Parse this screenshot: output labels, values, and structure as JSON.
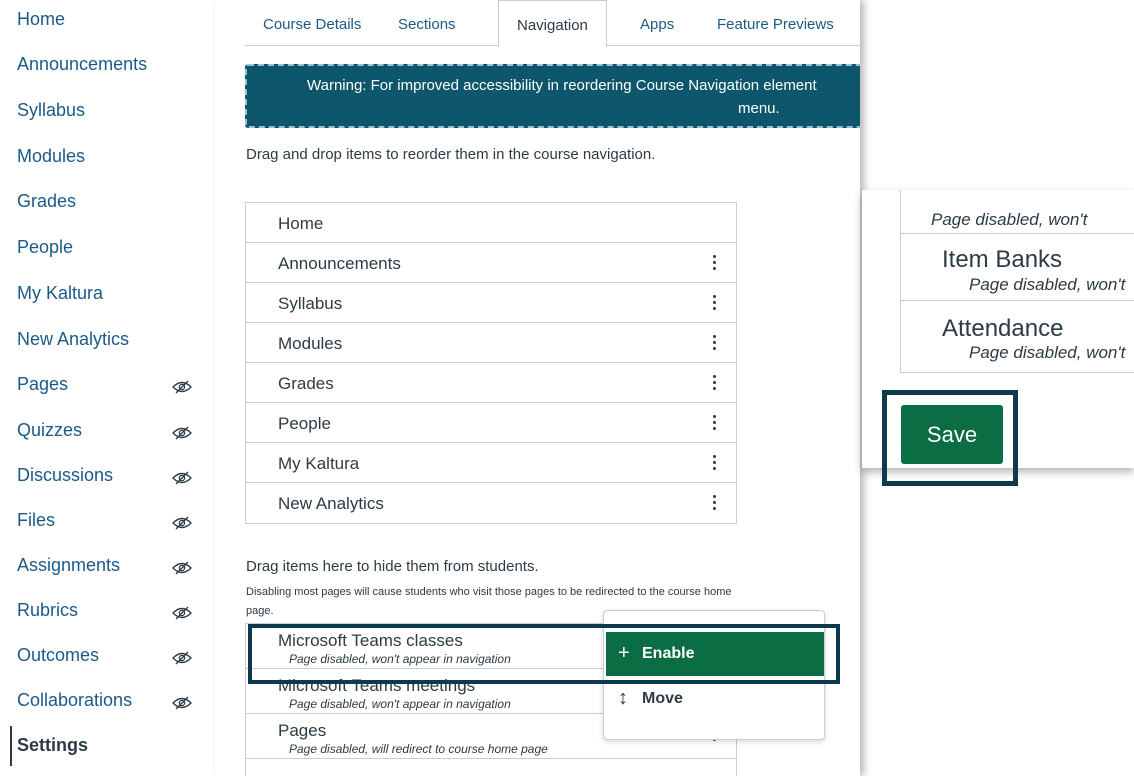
{
  "course_nav": {
    "items": [
      {
        "label": "Home",
        "hidden": false
      },
      {
        "label": "Announcements",
        "hidden": false
      },
      {
        "label": "Syllabus",
        "hidden": false
      },
      {
        "label": "Modules",
        "hidden": false
      },
      {
        "label": "Grades",
        "hidden": false
      },
      {
        "label": "People",
        "hidden": false
      },
      {
        "label": "My Kaltura",
        "hidden": false
      },
      {
        "label": "New Analytics",
        "hidden": false
      },
      {
        "label": "Pages",
        "hidden": true
      },
      {
        "label": "Quizzes",
        "hidden": true
      },
      {
        "label": "Discussions",
        "hidden": true
      },
      {
        "label": "Files",
        "hidden": true
      },
      {
        "label": "Assignments",
        "hidden": true
      },
      {
        "label": "Rubrics",
        "hidden": true
      },
      {
        "label": "Outcomes",
        "hidden": true
      },
      {
        "label": "Collaborations",
        "hidden": true
      },
      {
        "label": "Settings",
        "hidden": false,
        "active": true
      }
    ]
  },
  "tabs": [
    "Course Details",
    "Sections",
    "Navigation",
    "Apps",
    "Feature Previews"
  ],
  "active_tab": "Navigation",
  "warning": {
    "line1": "Warning: For improved accessibility in reordering Course Navigation element",
    "line2": "menu."
  },
  "instruction": "Drag and drop items to reorder them in the course navigation.",
  "enabled_items": [
    "Home",
    "Announcements",
    "Syllabus",
    "Modules",
    "Grades",
    "People",
    "My Kaltura",
    "New Analytics"
  ],
  "hidden_section": {
    "heading": "Drag items here to hide them from students.",
    "note": "Disabling most pages will cause students who visit those pages to be redirected to the course home page.",
    "items": [
      {
        "label": "Microsoft Teams classes",
        "sub": "Page disabled, won't appear in navigation"
      },
      {
        "label": "Microsoft Teams meetings",
        "sub": "Page disabled, won't appear in navigation"
      },
      {
        "label": "Pages",
        "sub": "Page disabled, will redirect to course home page"
      }
    ]
  },
  "menu": {
    "enable": {
      "icon": "+",
      "label": "Enable"
    },
    "move": {
      "icon": "↕",
      "label": "Move"
    }
  },
  "zoom": {
    "top_sub": "Page disabled, won't",
    "items": [
      {
        "title": "Item Banks",
        "sub": "Page disabled, won't"
      },
      {
        "title": "Attendance",
        "sub": "Page disabled, won't"
      }
    ]
  },
  "save_label": "Save",
  "colors": {
    "link": "#1b5a88",
    "primary": "#0b6d43",
    "warning_bg": "#0e566c",
    "highlight": "#0e3a4e"
  }
}
